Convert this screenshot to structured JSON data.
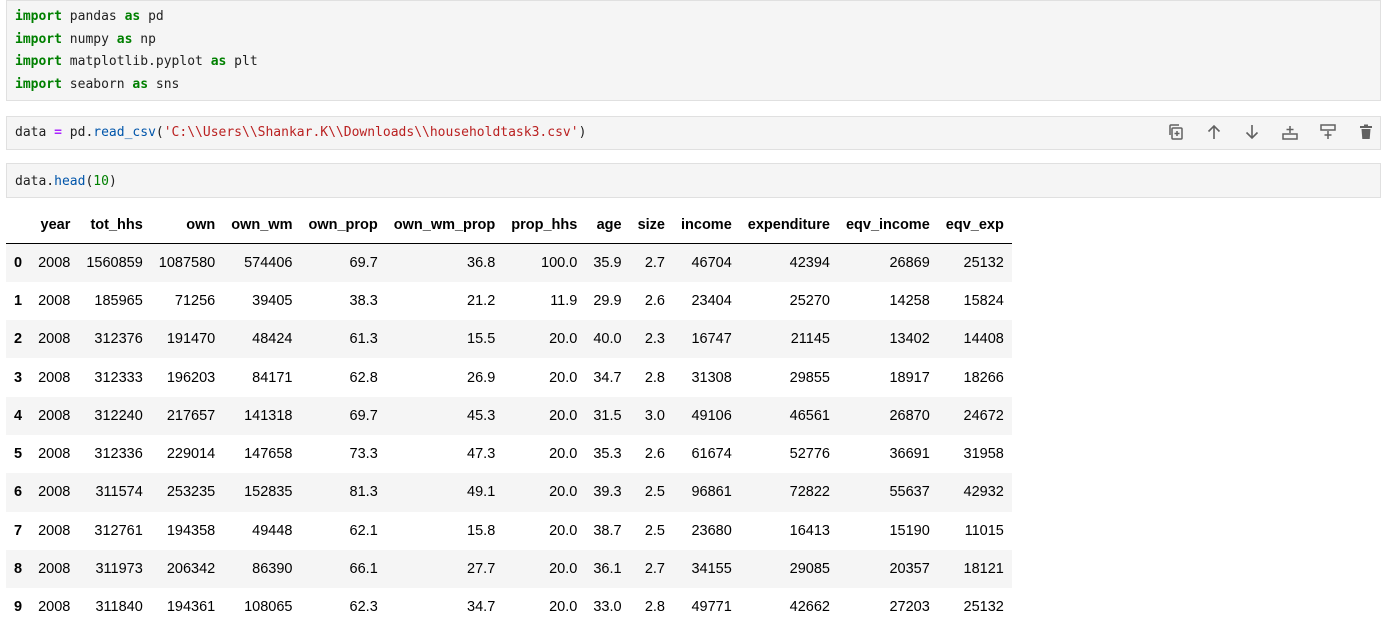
{
  "cells": {
    "imports": {
      "lines": [
        {
          "kw": "import",
          "mod": " pandas ",
          "as": "as",
          "alias": " pd"
        },
        {
          "kw": "import",
          "mod": " numpy ",
          "as": "as",
          "alias": " np"
        },
        {
          "kw": "import",
          "mod": " matplotlib.pyplot ",
          "as": "as",
          "alias": " plt"
        },
        {
          "kw": "import",
          "mod": " seaborn ",
          "as": "as",
          "alias": " sns"
        }
      ]
    },
    "read_csv": {
      "var": "data",
      "eq": "=",
      "obj": " pd.",
      "fn": "read_csv",
      "open": "(",
      "arg": "'C:\\\\Users\\\\Shankar.K\\\\Downloads\\\\householdtask3.csv'",
      "close": ")"
    },
    "head": {
      "obj": "data.",
      "fn": "head",
      "open": "(",
      "arg": "10",
      "close": ")"
    }
  },
  "toolbar": {
    "icons": [
      "copy-icon",
      "move-up-icon",
      "move-down-icon",
      "insert-below-icon",
      "insert-above-icon",
      "delete-icon"
    ]
  },
  "table": {
    "columns": [
      "",
      "year",
      "tot_hhs",
      "own",
      "own_wm",
      "own_prop",
      "own_wm_prop",
      "prop_hhs",
      "age",
      "size",
      "income",
      "expenditure",
      "eqv_income",
      "eqv_exp"
    ],
    "rows": [
      [
        "0",
        "2008",
        "1560859",
        "1087580",
        "574406",
        "69.7",
        "36.8",
        "100.0",
        "35.9",
        "2.7",
        "46704",
        "42394",
        "26869",
        "25132"
      ],
      [
        "1",
        "2008",
        "185965",
        "71256",
        "39405",
        "38.3",
        "21.2",
        "11.9",
        "29.9",
        "2.6",
        "23404",
        "25270",
        "14258",
        "15824"
      ],
      [
        "2",
        "2008",
        "312376",
        "191470",
        "48424",
        "61.3",
        "15.5",
        "20.0",
        "40.0",
        "2.3",
        "16747",
        "21145",
        "13402",
        "14408"
      ],
      [
        "3",
        "2008",
        "312333",
        "196203",
        "84171",
        "62.8",
        "26.9",
        "20.0",
        "34.7",
        "2.8",
        "31308",
        "29855",
        "18917",
        "18266"
      ],
      [
        "4",
        "2008",
        "312240",
        "217657",
        "141318",
        "69.7",
        "45.3",
        "20.0",
        "31.5",
        "3.0",
        "49106",
        "46561",
        "26870",
        "24672"
      ],
      [
        "5",
        "2008",
        "312336",
        "229014",
        "147658",
        "73.3",
        "47.3",
        "20.0",
        "35.3",
        "2.6",
        "61674",
        "52776",
        "36691",
        "31958"
      ],
      [
        "6",
        "2008",
        "311574",
        "253235",
        "152835",
        "81.3",
        "49.1",
        "20.0",
        "39.3",
        "2.5",
        "96861",
        "72822",
        "55637",
        "42932"
      ],
      [
        "7",
        "2008",
        "312761",
        "194358",
        "49448",
        "62.1",
        "15.8",
        "20.0",
        "38.7",
        "2.5",
        "23680",
        "16413",
        "15190",
        "11015"
      ],
      [
        "8",
        "2008",
        "311973",
        "206342",
        "86390",
        "66.1",
        "27.7",
        "20.0",
        "36.1",
        "2.7",
        "34155",
        "29085",
        "20357",
        "18121"
      ],
      [
        "9",
        "2008",
        "311840",
        "194361",
        "108065",
        "62.3",
        "34.7",
        "20.0",
        "33.0",
        "2.8",
        "49771",
        "42662",
        "27203",
        "25132"
      ]
    ]
  },
  "colors": {
    "keyword": "#008000",
    "operator": "#aa22ff",
    "string": "#ba2121",
    "function": "#0055aa",
    "cell_bg": "#f5f5f5",
    "icon": "#616161"
  }
}
